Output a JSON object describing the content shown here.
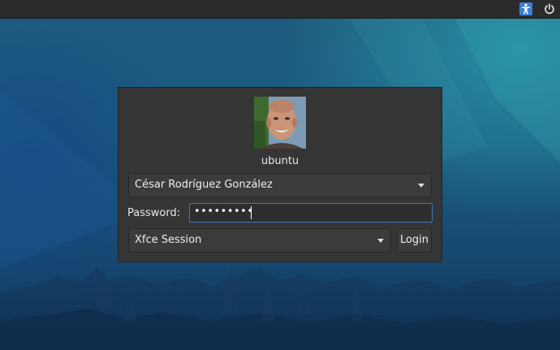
{
  "topbar": {
    "accessibility_icon": "accessibility-icon",
    "power_icon": "power-icon",
    "accent_color": "#3d7fd6"
  },
  "login": {
    "username": "ubuntu",
    "user_select": "César Rodríguez González",
    "password_label": "Password:",
    "password_mask": "•••••••••",
    "session_select": "Xfce Session",
    "login_label": "Login"
  }
}
